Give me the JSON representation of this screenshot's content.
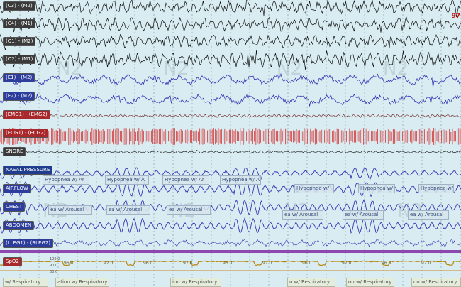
{
  "channels": [
    {
      "label": "(C3) - (M2)",
      "color": "#101010"
    },
    {
      "label": "(C4) - (M1)",
      "color": "#101010"
    },
    {
      "label": "(O1) - (M2)",
      "color": "#101010"
    },
    {
      "label": "(O2) - (M1)",
      "color": "#101010"
    },
    {
      "label": "(E1) - (M2)",
      "color": "#2b2b9e"
    },
    {
      "label": "(E2) - (M2)",
      "color": "#2b2b9e"
    },
    {
      "label": "(EMG1) - (EMG2)",
      "color": "#5a1010"
    },
    {
      "label": "(ECG1) - (ECG2)",
      "color": "#d63030"
    },
    {
      "label": "SNORE",
      "color": "#101010"
    },
    {
      "label": "NASAL PRESSURE",
      "color": "#3535b5"
    },
    {
      "label": "AIRFLOW",
      "color": "#3535b5"
    },
    {
      "label": "CHEST",
      "color": "#3535b5"
    },
    {
      "label": "ABDOMEN",
      "color": "#3535b5"
    },
    {
      "label": "(LLEG1) - (RLEG2)",
      "color": "#3535b5"
    },
    {
      "label": "SpO2",
      "color": "#b8860b"
    }
  ],
  "side_value": "97",
  "airflow_events": [
    "Hypopnea w/ Ar",
    "Hypopnea w/ A",
    "Hypopnea w/ Ar",
    "Hypopnea w/ A",
    "Hypopnea w/",
    "Hypopnea w/",
    "Hypopnea w/"
  ],
  "chest_events": [
    "ea w/ Arousal",
    "ea w/ Arousal",
    "ea w/ Arousal",
    "ea w/ Arousal",
    "ea w/ Arousal",
    "ea w/ Arousal"
  ],
  "bottom_events": [
    "w/ Respiratory",
    "ation w/ Respiratory",
    "ion w/ Respiratory",
    "n w/ Respiratory",
    "on w/ Respiratory",
    "on w/ Respiratory"
  ],
  "spo2_values": [
    "96.0",
    "97.0",
    "96.0",
    "97.0",
    "96.0",
    "97.0",
    "96.0",
    "97.0",
    "96.0",
    "97.0"
  ],
  "spo2_scale": [
    "100.0",
    "90.0",
    "80.0"
  ],
  "stage_watermark": "N2",
  "colors": {
    "background": "#d8ecf1",
    "grid": "#7a8fa0",
    "eeg": "#101010",
    "resp": "#3535b5",
    "ecg": "#d63030",
    "spo2": "#b8860b",
    "purple": "#7a1f9e"
  }
}
